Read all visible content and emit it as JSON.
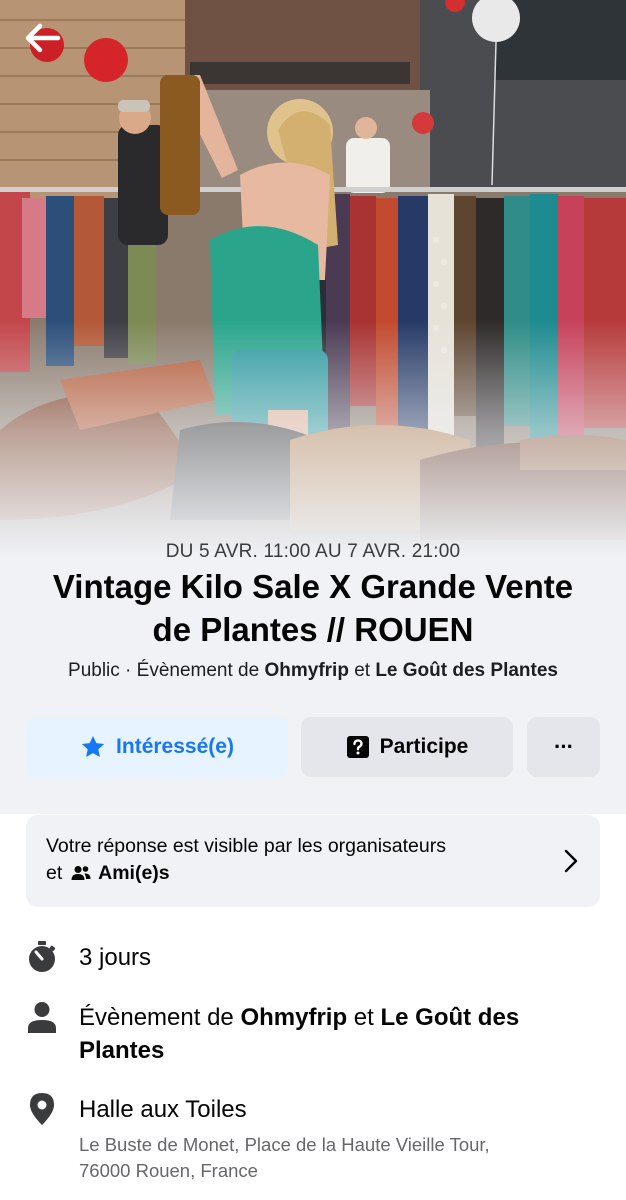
{
  "header": {
    "back_icon": "arrow-left-icon"
  },
  "event": {
    "date_range": "DU 5 AVR. 11:00 AU 7 AVR. 21:00",
    "title": "Vintage Kilo Sale X Grande Vente de Plantes // ROUEN",
    "privacy": "Public",
    "separator": " · ",
    "hosted_by_prefix": "Évènement de ",
    "host_1": "Ohmyfrip",
    "host_joiner": " et ",
    "host_2": "Le Goût des Plantes"
  },
  "actions": {
    "interested_label": "Intéressé(e)",
    "interested_icon": "star-icon",
    "going_label": "Participe",
    "going_icon": "question-box-icon",
    "more_label": "···",
    "accent_color": "#1877f2"
  },
  "visibility": {
    "text": "Votre réponse est visible par les organisateurs",
    "and": "et",
    "audience": "Ami(e)s",
    "audience_icon": "friends-icon"
  },
  "details": {
    "duration": "3 jours",
    "duration_icon": "stopwatch-icon",
    "hosts_prefix": "Évènement de ",
    "host_1": "Ohmyfrip",
    "joiner": " et ",
    "host_2": "Le Goût des Plantes",
    "hosts_icon": "person-icon",
    "venue": "Halle aux Toiles",
    "address_line_1": "Le Buste de Monet, Place de la Haute Vieille Tour,",
    "address_line_2": "76000 Rouen, France",
    "location_icon": "location-pin-icon"
  }
}
